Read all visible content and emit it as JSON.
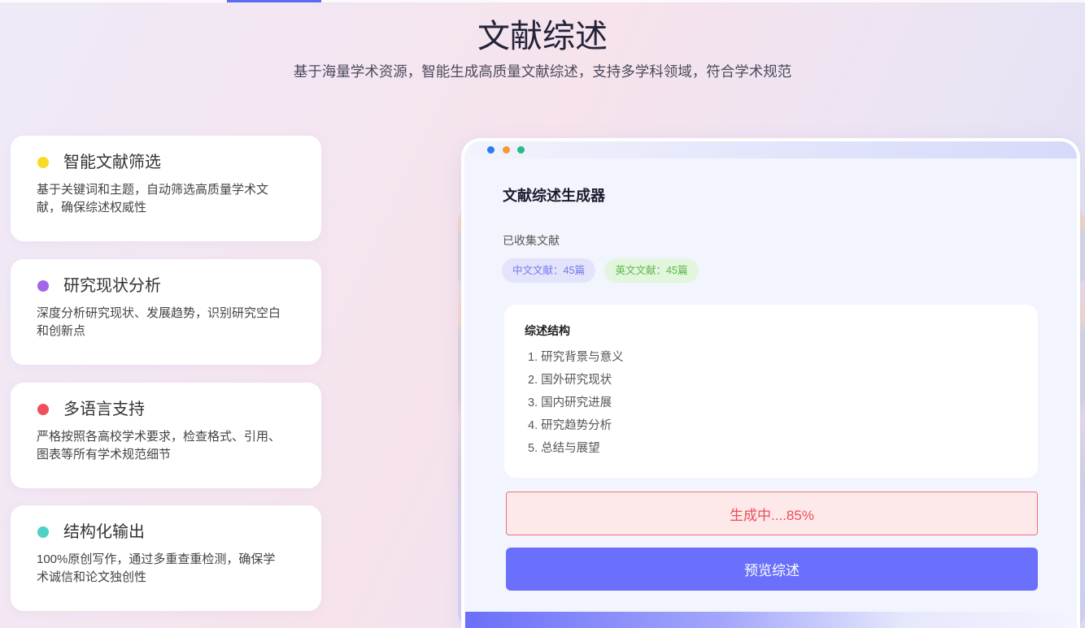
{
  "page": {
    "title": "文献综述",
    "subtitle": "基于海量学术资源，智能生成高质量文献综述，支持多学科领域，符合学术规范"
  },
  "colors": {
    "accent": "#5b6cf4"
  },
  "features": [
    {
      "title": "智能文献筛选",
      "description": "基于关键词和主题，自动筛选高质量学术文献，确保综述权威性",
      "dot_color": "#f7dc26"
    },
    {
      "title": "研究现状分析",
      "description": "深度分析研究现状、发展趋势，识别研究空白和创新点",
      "dot_color": "#a466e8"
    },
    {
      "title": "多语言支持",
      "description": "严格按照各高校学术要求，检查格式、引用、图表等所有学术规范细节",
      "dot_color": "#f0505e"
    },
    {
      "title": "结构化输出",
      "description": "100%原创写作，通过多重查重检测，确保学术诚信和论文独创性",
      "dot_color": "#4fd1c5"
    }
  ],
  "generator": {
    "window_dot_colors": [
      "#2a7cf0",
      "#f5993a",
      "#1fbf86"
    ],
    "title": "文献综述生成器",
    "collected_label": "已收集文献",
    "badges": [
      {
        "text": "中文文献：45篇",
        "bg": "#e3e3fb",
        "color": "#7578ee"
      },
      {
        "text": "英文文献：45篇",
        "bg": "#e2f5dd",
        "color": "#57b947"
      }
    ],
    "structure": {
      "heading": "综述结构",
      "items": [
        "1. 研究背景与意义",
        "2. 国外研究现状",
        "3. 国内研究进展",
        "4. 研究趋势分析",
        "5. 总结与展望"
      ]
    },
    "status": {
      "text": "生成中....85%",
      "bg": "#fde9ea",
      "border": "#ef7177",
      "color": "#ee4c57"
    },
    "preview_button": {
      "label": "预览综述",
      "bg": "#6a70fb"
    }
  }
}
